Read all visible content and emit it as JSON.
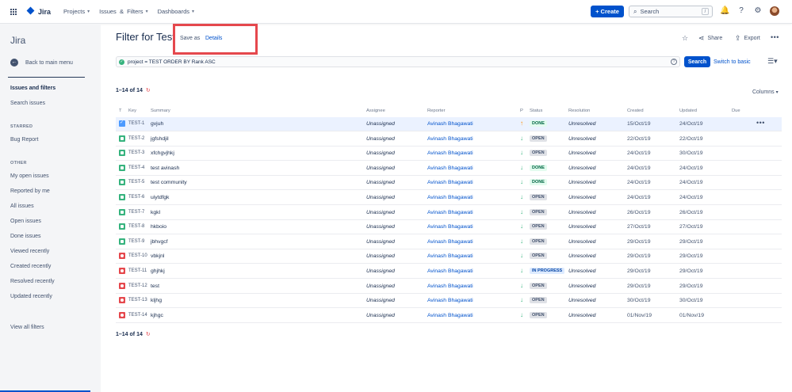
{
  "topnav": {
    "app_name": "Jira",
    "menu": [
      {
        "label": "Projects"
      },
      {
        "label": "Issues  &  Filters"
      },
      {
        "label": "Dashboards"
      }
    ],
    "create_label": "+ Create",
    "search_placeholder": "Search",
    "search_shortcut": "/"
  },
  "sidebar": {
    "title": "Jira",
    "back_label": "Back to main menu",
    "section_title": "Issues and filters",
    "search_issues": "Search issues",
    "starred_heading": "STARRED",
    "starred": [
      "Bug Report"
    ],
    "other_heading": "OTHER",
    "other": [
      "My open issues",
      "Reported by me",
      "All issues",
      "Open issues",
      "Done issues",
      "Viewed recently",
      "Created recently",
      "Resolved recently",
      "Updated recently"
    ],
    "view_all": "View all filters"
  },
  "header": {
    "title": "Filter for Test",
    "popup": {
      "save_as": "Save as",
      "details": "Details"
    },
    "share_label": "Share",
    "export_label": "Export"
  },
  "query": {
    "jql": "project = TEST ORDER BY Rank ASC",
    "search_button": "Search",
    "switch_label": "Switch to basic"
  },
  "results": {
    "count_top": "1–14 of 14",
    "count_bottom": "1–14 of 14",
    "columns_label": "Columns",
    "headers": {
      "t": "T",
      "key": "Key",
      "summary": "Summary",
      "assignee": "Assignee",
      "reporter": "Reporter",
      "p": "P",
      "status": "Status",
      "resolution": "Resolution",
      "created": "Created",
      "updated": "Updated",
      "due": "Due"
    },
    "rows": [
      {
        "type": "task",
        "key": "TEST-1",
        "summary": "gvjuh",
        "assignee": "Unassigned",
        "reporter": "Avinash Bhagawati",
        "priority": "up",
        "status": "DONE",
        "resolution": "Unresolved",
        "created": "15/Oct/19",
        "updated": "24/Oct/19"
      },
      {
        "type": "story",
        "key": "TEST-2",
        "summary": "jgfshdjil",
        "assignee": "Unassigned",
        "reporter": "Avinash Bhagawati",
        "priority": "down",
        "status": "OPEN",
        "resolution": "Unresolved",
        "created": "22/Oct/19",
        "updated": "22/Oct/19"
      },
      {
        "type": "story",
        "key": "TEST-3",
        "summary": "xfchgvjhkj",
        "assignee": "Unassigned",
        "reporter": "Avinash Bhagawati",
        "priority": "down",
        "status": "OPEN",
        "resolution": "Unresolved",
        "created": "24/Oct/19",
        "updated": "30/Oct/19"
      },
      {
        "type": "story",
        "key": "TEST-4",
        "summary": "test avinash",
        "assignee": "Unassigned",
        "reporter": "Avinash Bhagawati",
        "priority": "down",
        "status": "DONE",
        "resolution": "Unresolved",
        "created": "24/Oct/19",
        "updated": "24/Oct/19"
      },
      {
        "type": "story",
        "key": "TEST-5",
        "summary": "test community",
        "assignee": "Unassigned",
        "reporter": "Avinash Bhagawati",
        "priority": "down",
        "status": "DONE",
        "resolution": "Unresolved",
        "created": "24/Oct/19",
        "updated": "24/Oct/19"
      },
      {
        "type": "story",
        "key": "TEST-6",
        "summary": "uiytdfgk",
        "assignee": "Unassigned",
        "reporter": "Avinash Bhagawati",
        "priority": "down",
        "status": "OPEN",
        "resolution": "Unresolved",
        "created": "24/Oct/19",
        "updated": "24/Oct/19"
      },
      {
        "type": "story",
        "key": "TEST-7",
        "summary": "kgkl",
        "assignee": "Unassigned",
        "reporter": "Avinash Bhagawati",
        "priority": "down",
        "status": "OPEN",
        "resolution": "Unresolved",
        "created": "26/Oct/19",
        "updated": "26/Oct/19"
      },
      {
        "type": "story",
        "key": "TEST-8",
        "summary": "hkboio",
        "assignee": "Unassigned",
        "reporter": "Avinash Bhagawati",
        "priority": "down",
        "status": "OPEN",
        "resolution": "Unresolved",
        "created": "27/Oct/19",
        "updated": "27/Oct/19"
      },
      {
        "type": "story",
        "key": "TEST-9",
        "summary": "jbhvgcf",
        "assignee": "Unassigned",
        "reporter": "Avinash Bhagawati",
        "priority": "down",
        "status": "OPEN",
        "resolution": "Unresolved",
        "created": "29/Oct/19",
        "updated": "29/Oct/19"
      },
      {
        "type": "bug",
        "key": "TEST-10",
        "summary": "vbkjnl",
        "assignee": "Unassigned",
        "reporter": "Avinash Bhagawati",
        "priority": "down",
        "status": "OPEN",
        "resolution": "Unresolved",
        "created": "29/Oct/19",
        "updated": "29/Oct/19"
      },
      {
        "type": "bug",
        "key": "TEST-11",
        "summary": "ghjhkj",
        "assignee": "Unassigned",
        "reporter": "Avinash Bhagawati",
        "priority": "down",
        "status": "IN PROGRESS",
        "resolution": "Unresolved",
        "created": "29/Oct/19",
        "updated": "29/Oct/19"
      },
      {
        "type": "bug",
        "key": "TEST-12",
        "summary": "test",
        "assignee": "Unassigned",
        "reporter": "Avinash Bhagawati",
        "priority": "down",
        "status": "OPEN",
        "resolution": "Unresolved",
        "created": "29/Oct/19",
        "updated": "29/Oct/19"
      },
      {
        "type": "bug",
        "key": "TEST-13",
        "summary": "kljhg",
        "assignee": "Unassigned",
        "reporter": "Avinash Bhagawati",
        "priority": "down",
        "status": "OPEN",
        "resolution": "Unresolved",
        "created": "30/Oct/19",
        "updated": "30/Oct/19"
      },
      {
        "type": "bug",
        "key": "TEST-14",
        "summary": "kjhgc",
        "assignee": "Unassigned",
        "reporter": "Avinash Bhagawati",
        "priority": "down",
        "status": "OPEN",
        "resolution": "Unresolved",
        "created": "01/Nov/19",
        "updated": "01/Nov/19"
      }
    ]
  },
  "colors": {
    "accent": "#0052cc",
    "highlight_box": "#e5484d",
    "selected_row": "#ebf2ff"
  }
}
